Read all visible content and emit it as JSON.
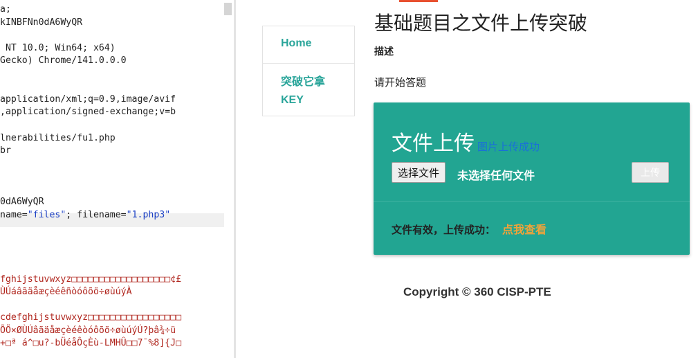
{
  "request_editor": {
    "lines": [
      {
        "text": "a;",
        "style": "normal"
      },
      {
        "text": "kINBFNn0dA6WyQR",
        "style": "normal"
      },
      {
        "text": "",
        "style": "normal"
      },
      {
        "text": " NT 10.0; Win64; x64)",
        "style": "normal"
      },
      {
        "text": "Gecko) Chrome/141.0.0.0",
        "style": "normal"
      },
      {
        "text": "",
        "style": "normal"
      },
      {
        "text": "",
        "style": "normal"
      },
      {
        "text": "application/xml;q=0.9,image/avif",
        "style": "normal"
      },
      {
        "text": ",application/signed-exchange;v=b",
        "style": "normal"
      },
      {
        "text": "",
        "style": "normal"
      },
      {
        "text": "lnerabilities/fu1.php",
        "style": "normal"
      },
      {
        "text": "br",
        "style": "normal"
      },
      {
        "text": "",
        "style": "normal"
      },
      {
        "text": "",
        "style": "normal"
      },
      {
        "text": "",
        "style": "normal"
      },
      {
        "text": "0dA6WyQR",
        "style": "normal"
      },
      {
        "text": "",
        "style": "disposition"
      },
      {
        "text": "",
        "style": "normal"
      },
      {
        "text": "",
        "style": "normal"
      },
      {
        "text": "",
        "style": "normal"
      },
      {
        "text": "",
        "style": "normal"
      },
      {
        "text": "fghijstuvwxyz□□□□□□□□□□□□□□□□□□¢£",
        "style": "red"
      },
      {
        "text": "ÙÚáâãäåæçèéêñòóôõö÷øùúýÀ",
        "style": "red"
      },
      {
        "text": "",
        "style": "normal"
      },
      {
        "text": "cdefghijstuvwxyz□□□□□□□□□□□□□□□□□",
        "style": "red"
      },
      {
        "text": "ÕÖ×ØÙÚâãäåæçèéêòóôõö÷øùúýÚ?þâ¾÷ü",
        "style": "red"
      },
      {
        "text": "+□ª á^□u?-bÜéåÔçÈù-LMHÛ□□7¯%8]{J□",
        "style": "red"
      },
      {
        "text": "",
        "style": "red"
      }
    ],
    "disposition_line": {
      "prefix": "name=",
      "name_value": "\"files\"",
      "middle": "; filename=",
      "filename_value": "\"1.php3\""
    }
  },
  "nav": {
    "home": "Home",
    "key": "突破它拿KEY"
  },
  "page": {
    "title": "基础题目之文件上传突破",
    "desc_label": "描述",
    "desc_text": "请开始答题"
  },
  "upload": {
    "title": "文件上传",
    "subtitle": "图片上传成功",
    "choose_button": "选择文件",
    "file_status": "未选择任何文件",
    "upload_button": "上传",
    "result_text": "文件有效，上传成功：",
    "result_link": "点我查看"
  },
  "footer": {
    "copyright": "Copyright © 360 CISP-PTE"
  },
  "colors": {
    "accent_teal": "#22a592",
    "nav_link": "#2aa59a",
    "result_link": "#f0a339",
    "subtitle_blue": "#1a6fd9",
    "string_blue": "#1a3fc4",
    "binary_red": "#b0261e"
  }
}
